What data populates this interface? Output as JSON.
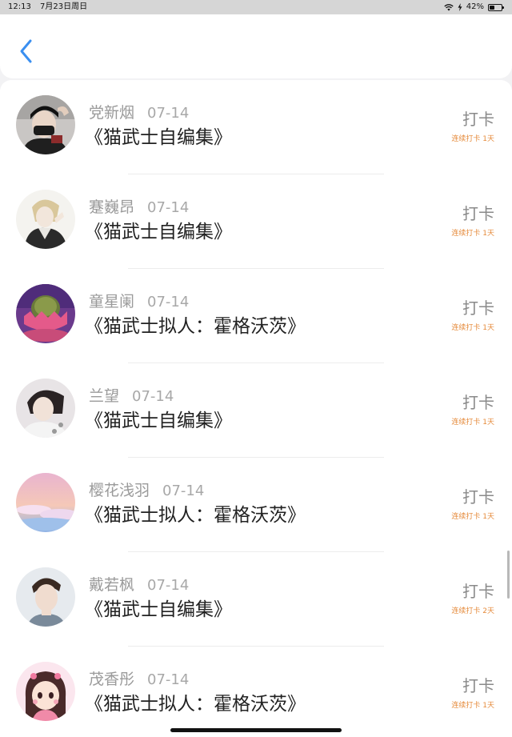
{
  "status_bar": {
    "time": "12:13",
    "date": "7月23日周日",
    "battery_percent": "42%",
    "battery_level": 0.42,
    "icons": [
      "wifi-icon",
      "charging-icon",
      "battery-icon"
    ]
  },
  "nav": {
    "back_icon": "chevron-left-icon",
    "accent_color": "#3a8ff0"
  },
  "entries": [
    {
      "name": "党新烟",
      "date": "07-14",
      "title": "《猫武士自编集》",
      "action": "打卡",
      "streak": "连续打卡 1天"
    },
    {
      "name": "蹇巍昂",
      "date": "07-14",
      "title": "《猫武士自编集》",
      "action": "打卡",
      "streak": "连续打卡 1天"
    },
    {
      "name": "童星阑",
      "date": "07-14",
      "title": "《猫武士拟人：霍格沃茨》",
      "action": "打卡",
      "streak": "连续打卡 1天"
    },
    {
      "name": "兰望",
      "date": "07-14",
      "title": "《猫武士自编集》",
      "action": "打卡",
      "streak": "连续打卡 1天"
    },
    {
      "name": "樱花浅羽",
      "date": "07-14",
      "title": "《猫武士拟人：霍格沃茨》",
      "action": "打卡",
      "streak": "连续打卡 1天"
    },
    {
      "name": "戴若枫",
      "date": "07-14",
      "title": "《猫武士自编集》",
      "action": "打卡",
      "streak": "连续打卡 2天"
    },
    {
      "name": "茂香彤",
      "date": "07-14",
      "title": "《猫武士拟人：霍格沃茨》",
      "action": "打卡",
      "streak": "连续打卡 1天"
    }
  ],
  "colors": {
    "streak": "#e58a3a",
    "name": "#9a9a9a",
    "title": "#222222"
  }
}
